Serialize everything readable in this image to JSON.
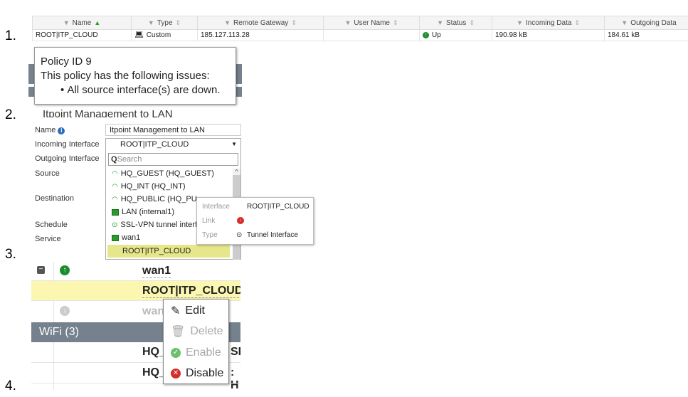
{
  "labels": [
    "1.",
    "2.",
    "3.",
    "4."
  ],
  "table": {
    "columns": [
      "Name",
      "Type",
      "Remote Gateway",
      "User Name",
      "Status",
      "Incoming Data",
      "Outgoing Data"
    ],
    "row": {
      "name": "ROOT|ITP_CLOUD",
      "type": "Custom",
      "remote_gateway": "185.127.113.28",
      "user_name": "",
      "status": "Up",
      "incoming": "190.98 kB",
      "outgoing": "184.61 kB"
    }
  },
  "tooltip": {
    "title": "Policy ID 9",
    "message": "This policy has the following issues:",
    "issue": "All source interface(s) are down.",
    "behind_text": "Itpoint Management to LAN"
  },
  "form": {
    "name_label": "Name",
    "name_value": "Itpoint Management to LAN",
    "incoming_label": "Incoming Interface",
    "incoming_value": "ROOT|ITP_CLOUD",
    "outgoing_label": "Outgoing Interface",
    "source_label": "Source",
    "destination_label": "Destination",
    "schedule_label": "Schedule",
    "service_label": "Service",
    "search_placeholder": "Search",
    "options": [
      "HQ_GUEST (HQ_GUEST)",
      "HQ_INT (HQ_INT)",
      "HQ_PUBLIC (HQ_PUB",
      "LAN (internal1)",
      "SSL-VPN tunnel interfa",
      "wan1",
      "ROOT|ITP_CLOUD"
    ],
    "popup": {
      "interface_label": "Interface",
      "interface_value": "ROOT|ITP_CLOUD",
      "link_label": "Link",
      "type_label": "Type",
      "type_value": "Tunnel Interface"
    }
  },
  "tree": {
    "row1": "wan1",
    "row2": "ROOT|ITP_CLOUD",
    "row3": "wan",
    "group": "WiFi (3)",
    "row4": "HQ_",
    "row4_tail": "SII",
    "row5": "HQ_",
    "row5_tail": ": H",
    "menu": [
      "Edit",
      "Delete",
      "Enable",
      "Disable"
    ]
  },
  "colors": {
    "accent_green": "#1e8c2e",
    "highlight": "#f7f3a8",
    "group_bar": "#75818c",
    "red": "#d62b2b"
  }
}
